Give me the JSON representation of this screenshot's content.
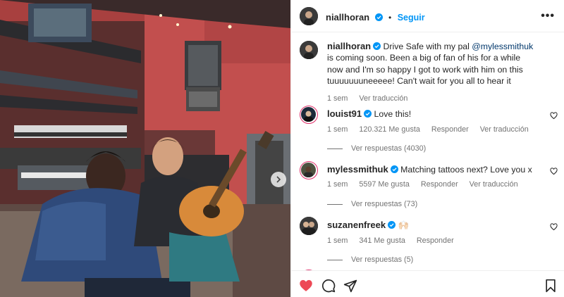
{
  "post": {
    "author": "niallhoran",
    "follow_label": "Seguir",
    "more_label": "•••"
  },
  "caption": {
    "username": "niallhoran",
    "text_before": "Drive Safe with my pal ",
    "mention": "@mylessmithuk",
    "text_after": " is coming soon. Been a big of fan of his for a while now and I'm so happy I got to work with him on this tuuuuuuuneeeee! Can't wait for you all to hear it",
    "time": "1 sem",
    "translate": "Ver traducción"
  },
  "comments": [
    {
      "username": "louist91",
      "text": "Love this!",
      "time": "1 sem",
      "likes": "120.321 Me gusta",
      "reply": "Responder",
      "translate": "Ver traducción",
      "replies": "Ver respuestas (4030)"
    },
    {
      "username": "mylessmithuk",
      "text": "Matching tattoos next? Love you x",
      "time": "1 sem",
      "likes": "5597 Me gusta",
      "reply": "Responder",
      "translate": "Ver traducción",
      "replies": "Ver respuestas (73)"
    },
    {
      "username": "suzanenfreek",
      "text": "🙌🏻",
      "time": "1 sem",
      "likes": "341 Me gusta",
      "reply": "Responder",
      "replies": "Ver respuestas (5)"
    }
  ],
  "colors": {
    "link": "#0095f6",
    "mention": "#00376b",
    "like_red": "#ed4956",
    "verified": "#0095f6"
  },
  "icons": [
    "heart-icon",
    "comment-icon",
    "share-icon",
    "bookmark-icon",
    "chevron-right-icon",
    "verified-icon"
  ]
}
